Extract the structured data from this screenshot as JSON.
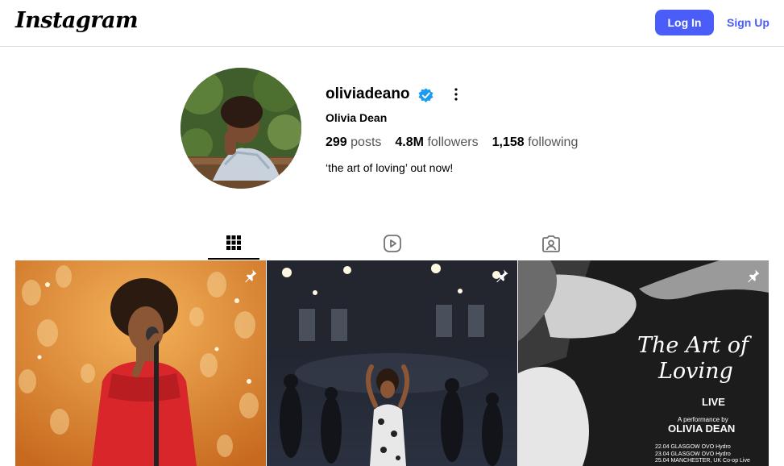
{
  "header": {
    "logo": "Instagram",
    "login_label": "Log In",
    "signup_label": "Sign Up"
  },
  "colors": {
    "accent": "#4a5df9",
    "verified": "#1d9bf0",
    "border": "#dbdbdb"
  },
  "profile": {
    "username": "oliviadeano",
    "full_name": "Olivia Dean",
    "stats": [
      {
        "value": "299",
        "label": "posts"
      },
      {
        "value": "4.8M",
        "label": "followers"
      },
      {
        "value": "1,158",
        "label": "following"
      }
    ],
    "bio": "‘the art of loving’ out now!"
  },
  "tabs": [
    {
      "name": "posts",
      "icon": "grid-icon",
      "active": true
    },
    {
      "name": "reels",
      "icon": "reels-icon",
      "active": false
    },
    {
      "name": "tagged",
      "icon": "tagged-icon",
      "active": false
    }
  ],
  "posts": [
    {
      "pinned": true,
      "icon": "pin-icon"
    },
    {
      "pinned": true,
      "icon": "pin-icon"
    },
    {
      "pinned": true,
      "icon": "pin-icon",
      "poster": {
        "title_line1": "The Art of",
        "title_line2": "Loving",
        "live": "LIVE",
        "byline": "A performance by",
        "artist": "OLIVIA DEAN",
        "dates": [
          "22.04 GLASGOW OVO Hydro",
          "23.04 GLASGOW OVO Hydro",
          "25.04 MANCHESTER, UK Co-op Live"
        ]
      }
    }
  ]
}
